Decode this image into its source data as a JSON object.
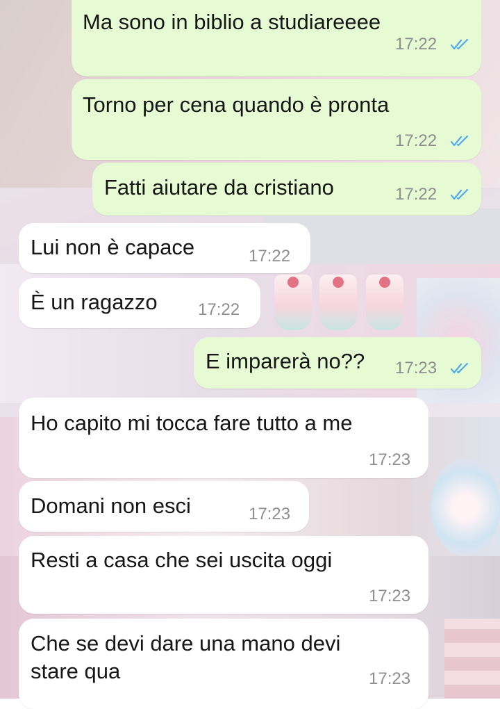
{
  "messages": [
    {
      "text": "Ma sono in biblio a studiareeee",
      "time": "17:22",
      "outgoing": true,
      "status": "read"
    },
    {
      "text": "Torno per cena quando è pronta",
      "time": "17:22",
      "outgoing": true,
      "status": "read"
    },
    {
      "text": "Fatti aiutare da cristiano",
      "time": "17:22",
      "outgoing": true,
      "status": "read"
    },
    {
      "text": "Lui non è capace",
      "time": "17:22",
      "outgoing": false
    },
    {
      "text": "È un ragazzo",
      "time": "17:22",
      "outgoing": false
    },
    {
      "text": "E imparerà no??",
      "time": "17:23",
      "outgoing": true,
      "status": "read"
    },
    {
      "text": "Ho capito mi tocca fare tutto a me",
      "time": "17:23",
      "outgoing": false
    },
    {
      "text": "Domani non esci",
      "time": "17:23",
      "outgoing": false
    },
    {
      "text": "Resti a casa che sei uscita oggi",
      "time": "17:23",
      "outgoing": false
    },
    {
      "text": "Che se devi dare una mano devi\nstare qua",
      "time": "17:23",
      "outgoing": false
    }
  ],
  "colors": {
    "outgoing_bubble": "#e6fbd3",
    "incoming_bubble": "#ffffff",
    "read_ticks": "#4fa9ea",
    "timestamp": "#8e8e8e"
  },
  "icons": {
    "read_status": "double-check-icon"
  }
}
